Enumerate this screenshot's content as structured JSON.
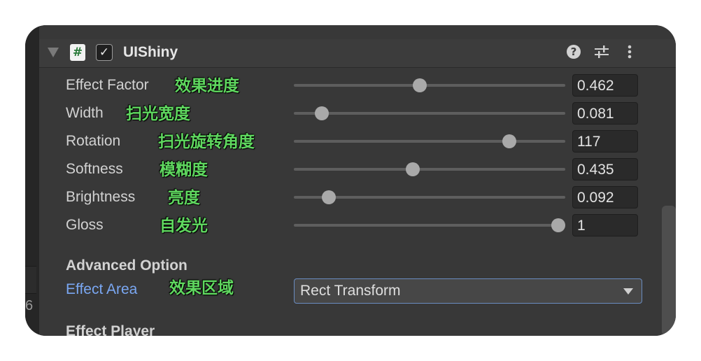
{
  "component": {
    "title": "UIShiny",
    "script_icon_glyph": "#",
    "enabled_glyph": "✓",
    "help_glyph": "?"
  },
  "properties": [
    {
      "label": "Effect Factor",
      "annotation": "效果进度",
      "value": "0.462",
      "slider_fraction": 0.462
    },
    {
      "label": "Width",
      "annotation": "扫光宽度",
      "value": "0.081",
      "slider_fraction": 0.081
    },
    {
      "label": "Rotation",
      "annotation": "扫光旋转角度",
      "value": "117",
      "slider_fraction": 0.81
    },
    {
      "label": "Softness",
      "annotation": "模糊度",
      "value": "0.435",
      "slider_fraction": 0.435
    },
    {
      "label": "Brightness",
      "annotation": "亮度",
      "value": "0.092",
      "slider_fraction": 0.11
    },
    {
      "label": "Gloss",
      "annotation": "自发光",
      "value": "1",
      "slider_fraction": 1.0
    }
  ],
  "advanced": {
    "title": "Advanced Option",
    "effect_area_label": "Effect Area",
    "effect_area_annotation": "效果区域",
    "effect_area_value": "Rect Transform"
  },
  "effect_player": {
    "title": "Effect Player"
  },
  "left_panel_text": "6",
  "colors": {
    "annotation": "#5fd75f",
    "link_label": "#7aa7f2",
    "panel_bg": "#383838",
    "header_bg": "#3c3c3c"
  }
}
